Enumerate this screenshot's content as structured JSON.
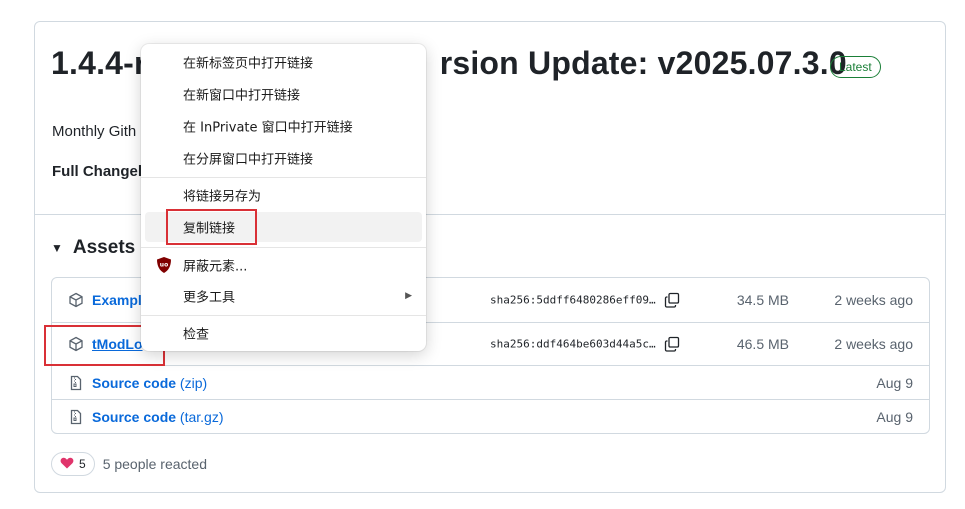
{
  "release": {
    "title": "1.4.4-r                              rsion Update: v2025.07.3.0",
    "title_left": "1.4.4-r",
    "title_right": "rsion Update: v2025.07.3.0",
    "latest_badge": "Latest",
    "description": "Monthly Gith",
    "changelog": "Full Changel"
  },
  "assets": {
    "title": "Assets",
    "rows": [
      {
        "name": "Example",
        "sha": "sha256:5ddff6480286eff09…",
        "size": "34.5 MB",
        "date": "2 weeks ago"
      },
      {
        "name": "tModLo",
        "sha": "sha256:ddf464be603d44a5c…",
        "size": "46.5 MB",
        "date": "2 weeks ago"
      },
      {
        "name": "Source code",
        "ext": "(zip)",
        "date": "Aug 9"
      },
      {
        "name": "Source code",
        "ext": "(tar.gz)",
        "date": "Aug 9"
      }
    ]
  },
  "reactions": {
    "count": "5",
    "text": "5 people reacted"
  },
  "context_menu": {
    "items": [
      "在新标签页中打开链接",
      "在新窗口中打开链接",
      "在 InPrivate 窗口中打开链接",
      "在分屏窗口中打开链接",
      "将链接另存为",
      "复制链接",
      "屏蔽元素...",
      "更多工具",
      "检查"
    ]
  },
  "colors": {
    "link": "#0969da",
    "latest_green": "#1a7f37",
    "highlight_red": "#d93036",
    "ublock_red": "#800000"
  },
  "icons": [
    "package-icon",
    "file-zip-icon",
    "copy-icon",
    "heart-icon",
    "ublock-icon",
    "chevron-right-icon",
    "triangle-down-icon"
  ]
}
